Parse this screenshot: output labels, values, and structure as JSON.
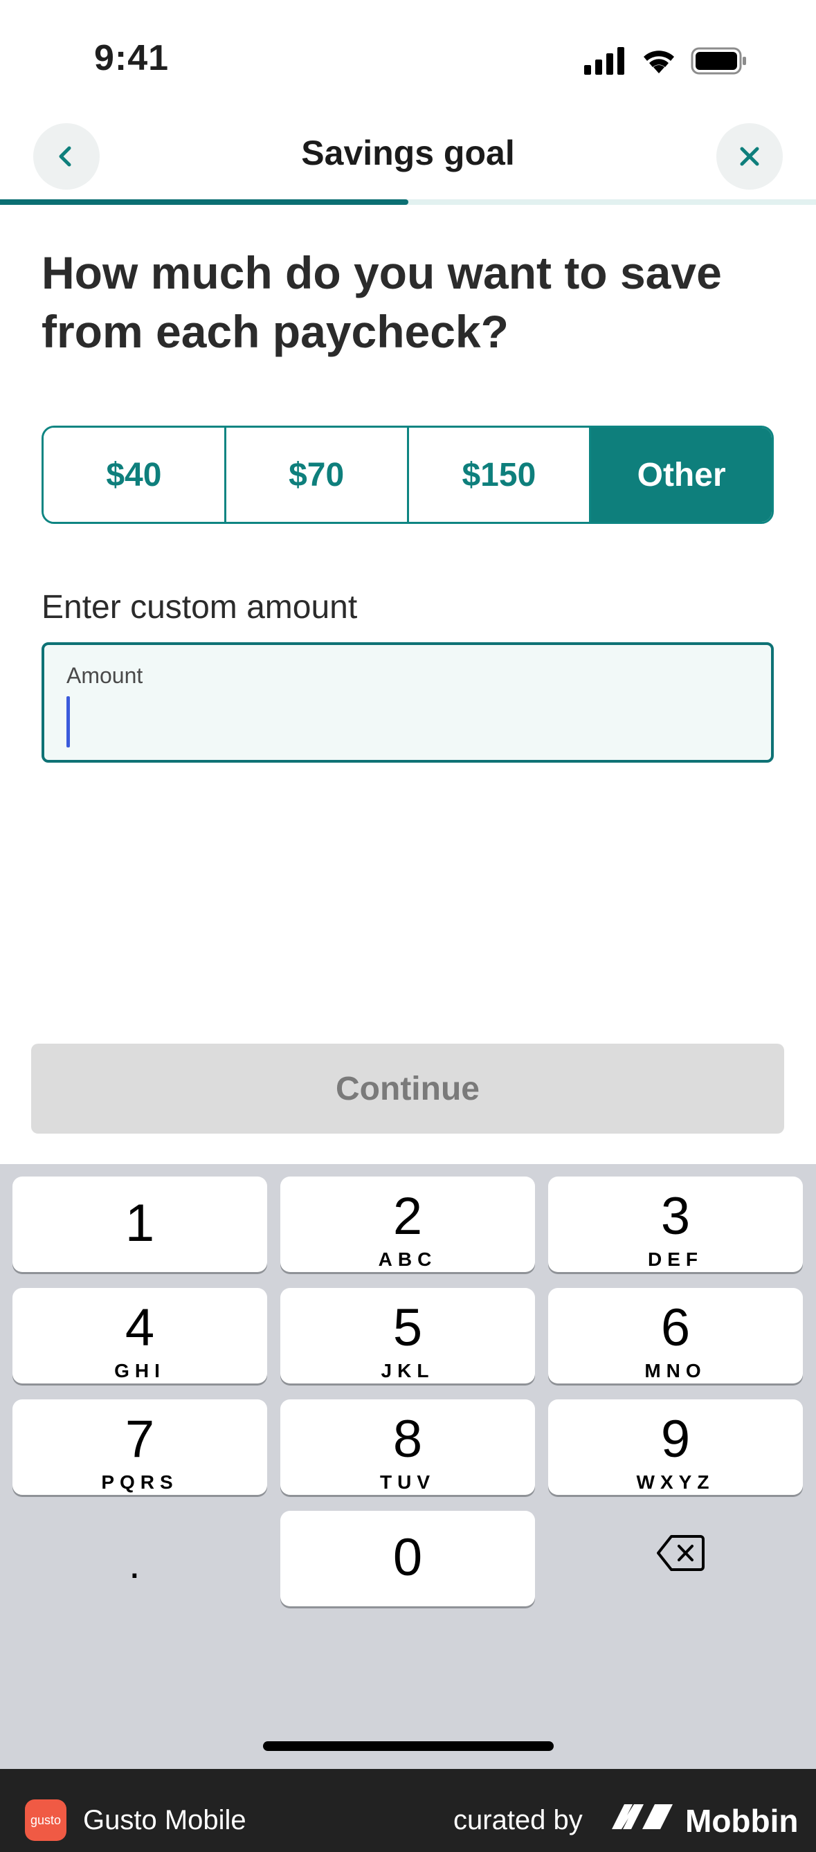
{
  "status_bar": {
    "time": "9:41"
  },
  "nav": {
    "title": "Savings goal",
    "progress_fraction": 0.5
  },
  "question": "How much do you want to save from each paycheck?",
  "amount_options": [
    {
      "label": "$40",
      "selected": false
    },
    {
      "label": "$70",
      "selected": false
    },
    {
      "label": "$150",
      "selected": false
    },
    {
      "label": "Other",
      "selected": true
    }
  ],
  "custom": {
    "section_label": "Enter custom amount",
    "field_label": "Amount",
    "value": ""
  },
  "continue_label": "Continue",
  "keyboard": {
    "keys": [
      {
        "num": "1",
        "letters": ""
      },
      {
        "num": "2",
        "letters": "ABC"
      },
      {
        "num": "3",
        "letters": "DEF"
      },
      {
        "num": "4",
        "letters": "GHI"
      },
      {
        "num": "5",
        "letters": "JKL"
      },
      {
        "num": "6",
        "letters": "MNO"
      },
      {
        "num": "7",
        "letters": "PQRS"
      },
      {
        "num": "8",
        "letters": "TUV"
      },
      {
        "num": "9",
        "letters": "WXYZ"
      },
      {
        "num": "0",
        "letters": ""
      }
    ],
    "decimal": ".",
    "delete_icon": "backspace-icon"
  },
  "footer": {
    "logo_text": "gusto",
    "app_name": "Gusto Mobile",
    "curated_by": "curated by",
    "brand": "Mobbin"
  },
  "colors": {
    "accent": "#0e7f7c",
    "progress": "#0b6f73",
    "disabled": "#dcdcdc",
    "keyboard_bg": "#d1d3d9"
  }
}
